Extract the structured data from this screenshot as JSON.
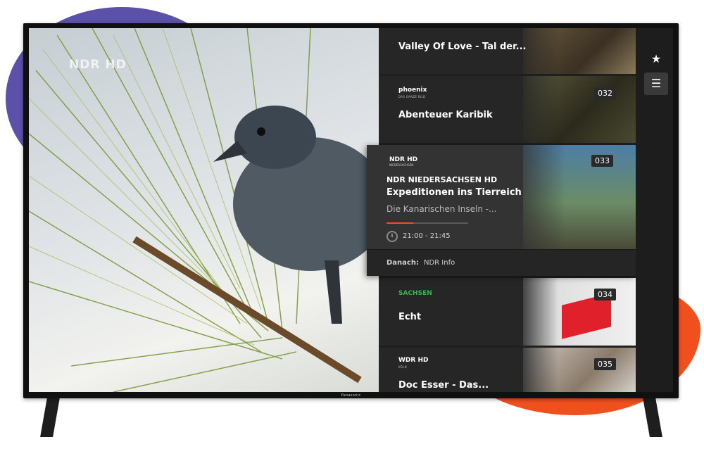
{
  "tv": {
    "brand": "Panasonic"
  },
  "video": {
    "watermark": "NDR HD"
  },
  "colors": {
    "accent": "#f0501e",
    "panel": "#262626",
    "active_card": "#333333"
  },
  "sidebar": {
    "items": [
      {
        "icon": "star-icon",
        "glyph": "★",
        "selected": false
      },
      {
        "icon": "channel-list-icon",
        "glyph": "☰",
        "selected": true
      }
    ]
  },
  "channels": [
    {
      "number": "",
      "logo": "",
      "title": "Valley Of Love - Tal der..."
    },
    {
      "number": "032",
      "logo": "phoenix",
      "logo_sub": "DAS GANZE BILD",
      "title": "Abenteuer Karibik"
    },
    {
      "number": "034",
      "logo": "SACHSEN",
      "logo_sub": "",
      "title": "Echt"
    },
    {
      "number": "035",
      "logo": "WDR HD",
      "logo_sub": "KÖLN",
      "title": "Doc Esser - Das..."
    }
  ],
  "active": {
    "number": "033",
    "logo": "NDR HD",
    "logo_sub": "NIEDERSACHSEN",
    "channel": "NDR NIEDERSACHSEN HD",
    "title": "Expeditionen ins Tierreich",
    "subtitle": "Die Kanarischen Inseln -...",
    "progress": 0.33,
    "time": "21:00 - 21:45",
    "next_label": "Danach:",
    "next_value": "NDR Info"
  }
}
